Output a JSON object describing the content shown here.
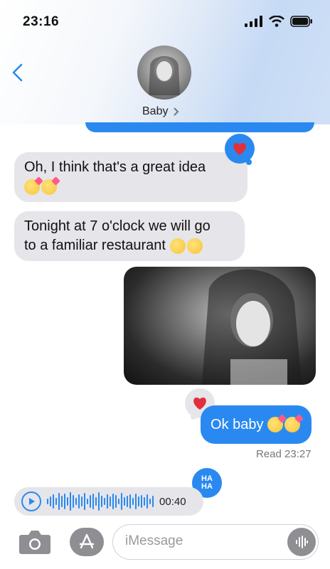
{
  "status_bar": {
    "time": "23:16"
  },
  "header": {
    "contact_name": "Baby",
    "back_icon": "chevron-left-icon"
  },
  "messages": {
    "received_1": {
      "line1": "Oh, I think that's a great idea"
    },
    "received_2": {
      "line1": "Tonight at 7 o'clock we will go",
      "line2": "to a familiar restaurant"
    },
    "sent_1": {
      "text": "Ok baby"
    },
    "read_receipt": "Read 23:27",
    "audio": {
      "duration": "00:40"
    },
    "tapback_haha": {
      "line1": "HA",
      "line2": "HA"
    }
  },
  "composer": {
    "placeholder": "iMessage"
  },
  "colors": {
    "accent": "#2a89f0",
    "bubble_gray": "#e5e5ea",
    "heart": "#e0303c"
  }
}
